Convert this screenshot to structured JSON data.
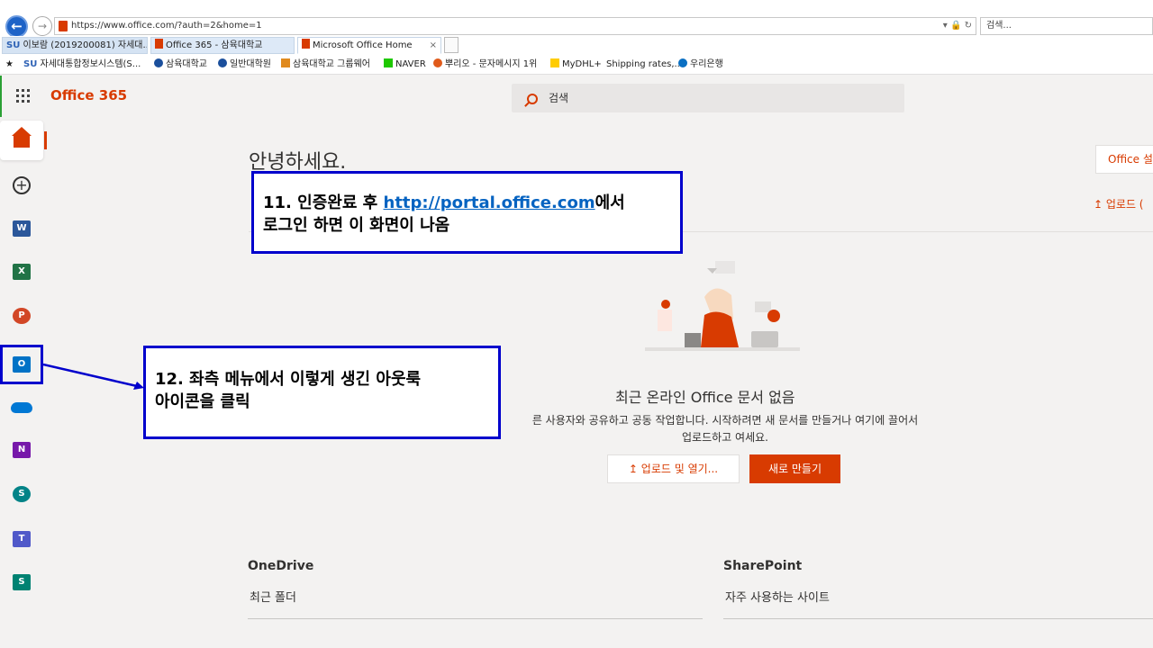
{
  "browser": {
    "url": "https://www.office.com/?auth=2&home=1",
    "url_tools": "▾ 🔒 ↻",
    "search_placeholder": "검색...",
    "tabs": [
      {
        "prefix": "SU",
        "label": "이보람 (2019200081) 자세대..."
      },
      {
        "label": "Office 365 - 삼육대학교"
      },
      {
        "label": "Microsoft Office Home",
        "close": "×"
      }
    ],
    "favorites": [
      {
        "label": "자세대통합정보시스템(S...",
        "prefix": "SU"
      },
      {
        "label": "삼육대학교"
      },
      {
        "label": "일반대학원"
      },
      {
        "label": "삼육대학교 그룹웨어"
      },
      {
        "label": "NAVER"
      },
      {
        "label": "뿌리오 - 문자메시지 1위"
      },
      {
        "label": "MyDHL+"
      },
      {
        "label": "Shipping rates,..."
      },
      {
        "label": "우리은행"
      }
    ]
  },
  "header": {
    "brand": "Office 365",
    "search_placeholder": "검색"
  },
  "rail": {
    "items": [
      {
        "name": "home"
      },
      {
        "name": "create",
        "glyph": "+"
      },
      {
        "name": "word",
        "glyph": "W"
      },
      {
        "name": "excel",
        "glyph": "X"
      },
      {
        "name": "powerpoint",
        "glyph": "P"
      },
      {
        "name": "outlook",
        "glyph": "O"
      },
      {
        "name": "onedrive"
      },
      {
        "name": "onenote",
        "glyph": "N"
      },
      {
        "name": "sharepoint",
        "glyph": "S"
      },
      {
        "name": "teams",
        "glyph": "T"
      },
      {
        "name": "sway",
        "glyph": "S"
      }
    ]
  },
  "main": {
    "greeting": "안녕하세요.",
    "install_button": "Office 설",
    "upload_link": "↥ 업로드 (",
    "empty_title": "최근 온라인 Office 문서 없음",
    "empty_desc_line1": "른 사용자와 공유하고 공동 작업합니다. 시작하려면 새 문서를 만들거나 여기에 끌어서",
    "empty_desc_line2": "업로드하고 여세요.",
    "upload_button": "↥  업로드 및 열기...",
    "new_button": "새로 만들기",
    "onedrive_title": "OneDrive",
    "onedrive_sub": "최근 폴더",
    "sharepoint_title": "SharePoint",
    "sharepoint_sub": "자주 사용하는 사이트"
  },
  "annotations": {
    "callout11_prefix": "11. 인증완료 후 ",
    "callout11_link": "http://portal.office.com",
    "callout11_suffix": "에서",
    "callout11_line2": "로그인 하면 이 화면이 나옴",
    "callout12_line1": "12. 좌측 메뉴에서 이렇게 생긴 아웃룩",
    "callout12_line2": "아이콘을 클릭"
  },
  "colors": {
    "accent": "#d83b01",
    "annotation_border": "#0000cc",
    "background": "#f3f2f1"
  }
}
